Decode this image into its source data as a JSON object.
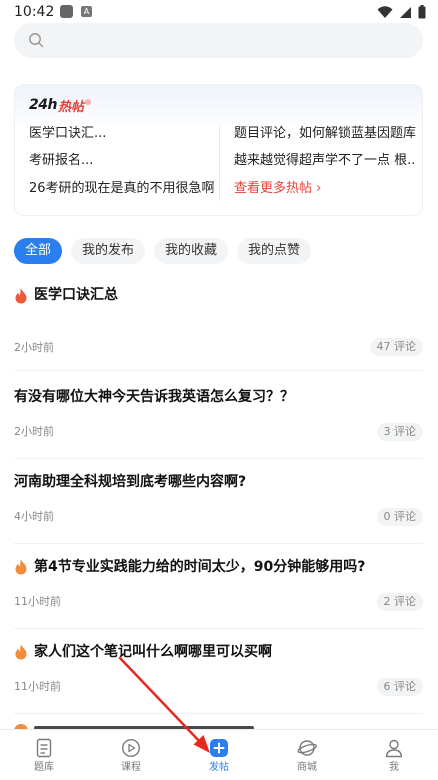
{
  "status_bar": {
    "time": "10:42",
    "badge": "A"
  },
  "hot_card": {
    "logo_24h": "24h",
    "logo_hot": "热帖",
    "left_items": [
      "医学口诀汇...",
      "考研报名...",
      "26考研的现在是真的不用很急啊"
    ],
    "right_items": [
      "题目评论，如何解锁蓝基因题库",
      "越来越觉得超声学不了一点 根..."
    ],
    "more_link": "查看更多热帖 ›"
  },
  "tabs": [
    {
      "label": "全部",
      "active": true
    },
    {
      "label": "我的发布",
      "active": false
    },
    {
      "label": "我的收藏",
      "active": false
    },
    {
      "label": "我的点赞",
      "active": false
    }
  ],
  "posts": [
    {
      "title": "医学口诀汇总",
      "hot": true,
      "time": "2小时前",
      "comments": "47 评论"
    },
    {
      "title": "有没有哪位大神今天告诉我英语怎么复习？？",
      "hot": false,
      "time": "2小时前",
      "comments": "3 评论"
    },
    {
      "title": "河南助理全科规培到底考哪些内容啊?",
      "hot": false,
      "time": "4小时前",
      "comments": "0 评论"
    },
    {
      "title": "第4节专业实践能力给的时间太少，90分钟能够用吗?",
      "hot": true,
      "time": "11小时前",
      "comments": "2 评论"
    },
    {
      "title": "家人们这个笔记叫什么啊哪里可以买啊",
      "hot": true,
      "time": "11小时前",
      "comments": "6 评论"
    }
  ],
  "bottom_nav": [
    {
      "label": "题库",
      "icon": "document-icon",
      "active": false
    },
    {
      "label": "课程",
      "icon": "play-circle-icon",
      "active": false
    },
    {
      "label": "发帖",
      "icon": "plus-square-icon",
      "active": true
    },
    {
      "label": "商城",
      "icon": "planet-icon",
      "active": false
    },
    {
      "label": "我",
      "icon": "person-icon",
      "active": false
    }
  ],
  "colors": {
    "accent": "#2a7ef0",
    "hot": "#e8413a",
    "annotation_arrow": "#e8271e"
  }
}
